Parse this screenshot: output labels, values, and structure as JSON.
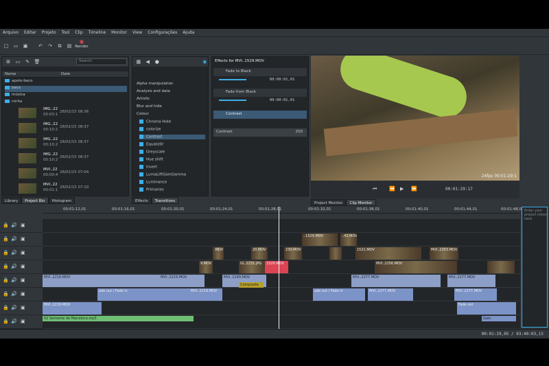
{
  "menu": [
    "Arquivo",
    "Editar",
    "Projeto",
    "Tool",
    "Clip",
    "Timeline",
    "Monitor",
    "View",
    "Configurações",
    "Ajuda"
  ],
  "toolbar": {
    "render_label": "Render"
  },
  "bin": {
    "search_placeholder": "Search",
    "col_name": "Name",
    "col_date": "Date",
    "folders": [
      "apoio-beco",
      "beco",
      "música",
      "ninho"
    ],
    "clips": [
      {
        "name": "IMG..22",
        "dur": "00:03:1",
        "date": "28/02/15 08:36"
      },
      {
        "name": "IMG..22",
        "dur": "00:10:2",
        "date": "28/02/15 08:37"
      },
      {
        "name": "IMG..22",
        "dur": "00:10:2",
        "date": "28/02/15 08:37"
      },
      {
        "name": "IMG..22",
        "dur": "00:10:2",
        "date": "28/02/15 08:37"
      },
      {
        "name": "MVI..22",
        "dur": "00:00:4",
        "date": "28/02/15 07:04"
      },
      {
        "name": "MVI..22",
        "dur": "00:01:1",
        "date": "28/02/15 07:10"
      }
    ],
    "tabs": [
      "Library",
      "Project Bin",
      "Histogram"
    ]
  },
  "effects_list": {
    "items": [
      "Alpha manipulation",
      "Analysis and data",
      "Artistic",
      "Blur and hide",
      "Colour",
      "Chroma Hold",
      "colorize",
      "Contrast",
      "Equaliz0r",
      "Greyscale",
      "Hue shift",
      "Invert",
      "LumaLiftGainGamma",
      "Luminance",
      "Primaries"
    ],
    "tabs": [
      "Effects",
      "Transitions"
    ]
  },
  "stack": {
    "title": "Effects for MVI..1529.MOV",
    "fx": [
      {
        "name": "Fade to Black",
        "time": "00:00:01,01"
      },
      {
        "name": "Fade from Black",
        "time": "00:00:01,01"
      },
      {
        "name": "Contrast",
        "param": "Contrast",
        "value": "250"
      }
    ]
  },
  "monitor": {
    "overlay": "24fps 00:01:29:1",
    "timecode": "00:01:29:17",
    "tabs": [
      "Project Monitor",
      "Clip Monitor"
    ]
  },
  "notes": {
    "placeholder": "Enter your project notes here"
  },
  "ruler": [
    "00:01:12,01",
    "00:01:16,01",
    "00:01:20,01",
    "00:01:24,01",
    "00:01:28,01",
    "00:01:32,01",
    "00:01:36,01",
    "00:01:40,01",
    "00:01:44,01",
    "00:01:48,01"
  ],
  "clips": {
    "t1": [
      "..1529.MOV",
      "..42.MOV"
    ],
    "t2": [
      ".MOV",
      "20.MOV",
      "230.MOV",
      "1521.MOV",
      "MVI..2253.MOV"
    ],
    "t3": [
      "9.MOV",
      "IG..2231.JPG",
      "1529.MOV",
      "MVI..2256.MOV"
    ],
    "t4": [
      "MVI..2219.MOV",
      "MVI..2219.MOV",
      "MVI..2249.MOV",
      "MVI..2277.MOV",
      "MVI..2277.MOV"
    ],
    "composite": "Composite",
    "a1": [
      "ade out / Fade in",
      "MVI..2219.MOV",
      "ade out / Fade in",
      "MVI..2277.MOV",
      "MVI..2277.MOV"
    ],
    "a2": [
      "MVI..2219.MOV",
      "Fade out"
    ],
    "a3": [
      "02 Semente de Mandioca.mp3",
      "Gain"
    ]
  },
  "status": {
    "time": "00:01:29,05 / 03:40:03,15"
  }
}
